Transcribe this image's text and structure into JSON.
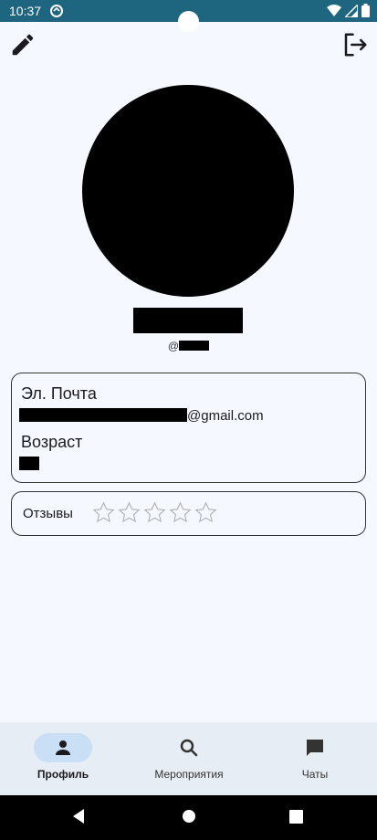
{
  "status_bar": {
    "time": "10:37",
    "app_icon": "sync-icon",
    "icons": [
      "wifi-icon",
      "signal-icon",
      "battery-icon"
    ],
    "background": "#1e6680"
  },
  "toolbar": {
    "edit_icon": "pencil-icon",
    "logout_icon": "logout-icon"
  },
  "profile": {
    "avatar": "redacted",
    "name": "",
    "username_prefix": "@"
  },
  "info": {
    "email_label": "Эл. Почта",
    "email_suffix": "@gmail.com",
    "age_label": "Возраст"
  },
  "reviews": {
    "label": "Отзывы",
    "rating": 0,
    "max_rating": 5
  },
  "bottom_nav": {
    "items": [
      {
        "label": "Профиль",
        "icon": "person-icon",
        "active": true
      },
      {
        "label": "Мероприятия",
        "icon": "search-icon",
        "active": false
      },
      {
        "label": "Чаты",
        "icon": "chat-icon",
        "active": false
      }
    ],
    "active_color": "#c9dff5"
  },
  "system_nav": {
    "buttons": [
      "back-icon",
      "home-icon",
      "recents-icon"
    ]
  }
}
